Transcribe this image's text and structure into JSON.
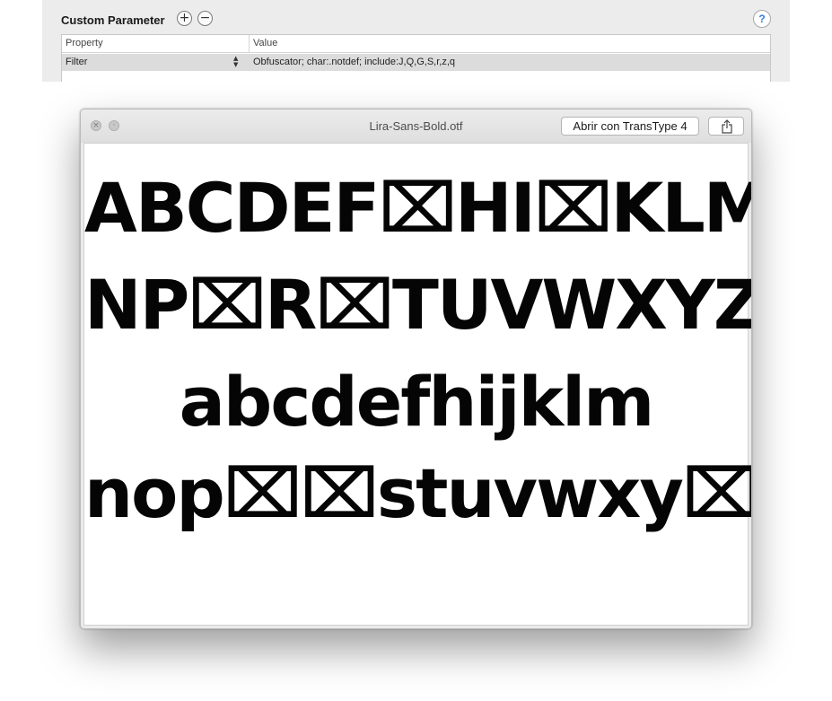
{
  "panel": {
    "title": "Custom Parameter",
    "add_icon": "plus-icon",
    "add_glyph": "+",
    "remove_icon": "minus-icon",
    "remove_glyph": "−",
    "help_glyph": "?",
    "table": {
      "columns": [
        "Property",
        "Value"
      ],
      "rows": [
        {
          "property": "Filter",
          "value": "Obfuscator; char:.notdef; include:J,Q,G,S,r,z,q"
        }
      ]
    },
    "stepper_glyph": "▲▼"
  },
  "window": {
    "title": "Lira-Sans-Bold.otf",
    "open_with_label": "Abrir con TransType 4",
    "share_icon": "share-icon",
    "close_glyph": "×",
    "fullscreen_glyph": "⤢",
    "preview_lines": [
      "ABCDEF⌧HI⌧KLM",
      "NP⌧R⌧TUVWXYZ",
      "abcdefhijklm",
      "nop⌧⌧stuvwxy⌧"
    ],
    "notdef_icon": "notdef-box-icon"
  }
}
